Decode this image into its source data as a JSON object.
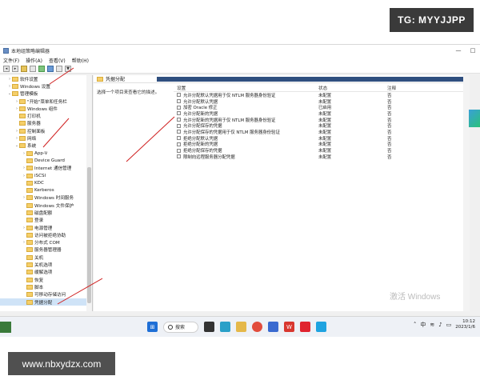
{
  "watermark_top": "TG: MYYJJPP",
  "watermark_bottom": "www.nbxydzx.com",
  "window": {
    "title": "本地组策略编辑器",
    "controls": {
      "min": "—",
      "max": "□"
    }
  },
  "menu": [
    "文件(F)",
    "操作(A)",
    "查看(V)",
    "帮助(H)"
  ],
  "tree": [
    {
      "label": "软件设置",
      "indent": 1,
      "arrow": "›"
    },
    {
      "label": "Windows 设置",
      "indent": 1,
      "arrow": "›"
    },
    {
      "label": "管理模板",
      "indent": 1,
      "arrow": "⌄"
    },
    {
      "label": "\"开始\"菜单和任务栏",
      "indent": 2,
      "arrow": "›"
    },
    {
      "label": "Windows 组件",
      "indent": 2,
      "arrow": "›"
    },
    {
      "label": "打印机",
      "indent": 2,
      "arrow": ""
    },
    {
      "label": "服务器",
      "indent": 2,
      "arrow": ""
    },
    {
      "label": "控制面板",
      "indent": 2,
      "arrow": "›"
    },
    {
      "label": "网络",
      "indent": 2,
      "arrow": "›"
    },
    {
      "label": "系统",
      "indent": 2,
      "arrow": "⌄"
    },
    {
      "label": "App-V",
      "indent": 3,
      "arrow": "›"
    },
    {
      "label": "Device Guard",
      "indent": 3,
      "arrow": ""
    },
    {
      "label": "Internet 通信管理",
      "indent": 3,
      "arrow": "›"
    },
    {
      "label": "iSCSI",
      "indent": 3,
      "arrow": "›"
    },
    {
      "label": "KDC",
      "indent": 3,
      "arrow": ""
    },
    {
      "label": "Kerberos",
      "indent": 3,
      "arrow": ""
    },
    {
      "label": "Windows 时间服务",
      "indent": 3,
      "arrow": "›"
    },
    {
      "label": "Windows 文件保护",
      "indent": 3,
      "arrow": ""
    },
    {
      "label": "磁盘配额",
      "indent": 3,
      "arrow": ""
    },
    {
      "label": "登录",
      "indent": 3,
      "arrow": ""
    },
    {
      "label": "电源管理",
      "indent": 3,
      "arrow": "›"
    },
    {
      "label": "访问被拒绝协助",
      "indent": 3,
      "arrow": ""
    },
    {
      "label": "分布式 COM",
      "indent": 3,
      "arrow": "›"
    },
    {
      "label": "服务器管理器",
      "indent": 3,
      "arrow": ""
    },
    {
      "label": "关机",
      "indent": 3,
      "arrow": ""
    },
    {
      "label": "关机选项",
      "indent": 3,
      "arrow": ""
    },
    {
      "label": "缓解选项",
      "indent": 3,
      "arrow": ""
    },
    {
      "label": "恢复",
      "indent": 3,
      "arrow": ""
    },
    {
      "label": "脚本",
      "indent": 3,
      "arrow": ""
    },
    {
      "label": "可移动存储访问",
      "indent": 3,
      "arrow": ""
    },
    {
      "label": "凭据分配",
      "indent": 3,
      "arrow": "",
      "selected": true
    }
  ],
  "right": {
    "header": "凭据分配",
    "description": "选择一个项目来查看它的描述。",
    "columns": {
      "setting": "设置",
      "state": "状态",
      "comment": "注释"
    },
    "rows": [
      {
        "setting": "允许分配默认凭据用于仅 NTLM 服务器身份验证",
        "state": "未配置",
        "comment": "否"
      },
      {
        "setting": "允许分配默认凭据",
        "state": "未配置",
        "comment": "否"
      },
      {
        "setting": "加密 Oracle 修正",
        "state": "已启用",
        "comment": "否"
      },
      {
        "setting": "允许分配新的凭据",
        "state": "未配置",
        "comment": "否"
      },
      {
        "setting": "允许分配新的凭据用于仅 NTLM 服务器身份验证",
        "state": "未配置",
        "comment": "否"
      },
      {
        "setting": "允许分配保存的凭据",
        "state": "未配置",
        "comment": "否"
      },
      {
        "setting": "允许分配保存的凭据用于仅 NTLM 服务器身份验证",
        "state": "未配置",
        "comment": "否"
      },
      {
        "setting": "拒绝分配默认凭据",
        "state": "未配置",
        "comment": "否"
      },
      {
        "setting": "拒绝分配新的凭据",
        "state": "未配置",
        "comment": "否"
      },
      {
        "setting": "拒绝分配保存的凭据",
        "state": "未配置",
        "comment": "否"
      },
      {
        "setting": "限制向远程服务器分配凭据",
        "state": "未配置",
        "comment": "否"
      }
    ],
    "activate_text": "激活 Windows"
  },
  "taskbar": {
    "search_label": "搜索",
    "time": "10:12",
    "date": "2023/1/6",
    "lang": "中"
  }
}
